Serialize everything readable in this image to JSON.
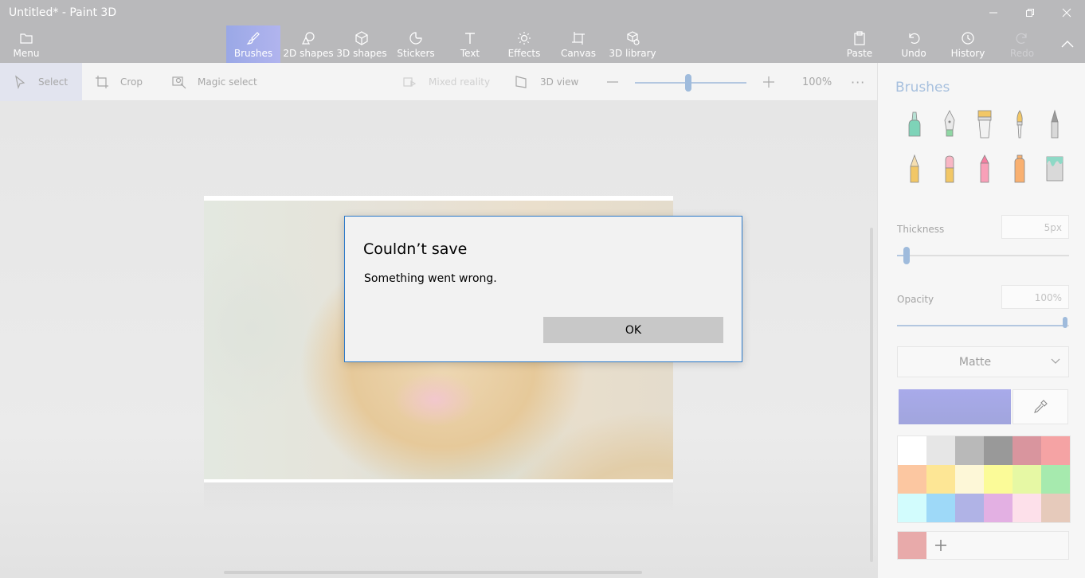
{
  "window": {
    "title": "Untitled* - Paint 3D"
  },
  "ribbon": {
    "menu_label": "Menu",
    "tools": [
      {
        "label": "Brushes"
      },
      {
        "label": "2D shapes"
      },
      {
        "label": "3D shapes"
      },
      {
        "label": "Stickers"
      },
      {
        "label": "Text"
      },
      {
        "label": "Effects"
      },
      {
        "label": "Canvas"
      },
      {
        "label": "3D library"
      }
    ],
    "paste_label": "Paste",
    "undo_label": "Undo",
    "history_label": "History",
    "redo_label": "Redo"
  },
  "toolbar": {
    "select_label": "Select",
    "crop_label": "Crop",
    "magic_select_label": "Magic select",
    "mixed_reality_label": "Mixed reality",
    "view_3d_label": "3D view",
    "zoom_value": "100%",
    "zoom_slider_fraction": 0.48
  },
  "panel": {
    "title": "Brushes",
    "brushes": [
      "marker",
      "calligraphy-pen",
      "oil-brush",
      "watercolor",
      "pixel-pen",
      "pencil",
      "eraser",
      "crayon",
      "spray-can",
      "fill"
    ],
    "thickness_label": "Thickness",
    "thickness_value": "5px",
    "opacity_label": "Opacity",
    "opacity_value": "100%",
    "finish_value": "Matte",
    "current_color": "#a8aaea",
    "palette": [
      "#ffffff",
      "#e6e6e6",
      "#b9b9b9",
      "#999999",
      "#d9959e",
      "#f5a3a4",
      "#fcc7a1",
      "#fde695",
      "#fdf7d7",
      "#fbfb98",
      "#e6f8a4",
      "#a6eaae",
      "#d2fcfd",
      "#9ed9f8",
      "#b0b3e6",
      "#e3b0e3",
      "#fde0ea",
      "#e6cabb"
    ],
    "custom_color": "#e8aaaa"
  },
  "dialog": {
    "title": "Couldn’t save",
    "message": "Something went wrong.",
    "ok_label": "OK"
  }
}
